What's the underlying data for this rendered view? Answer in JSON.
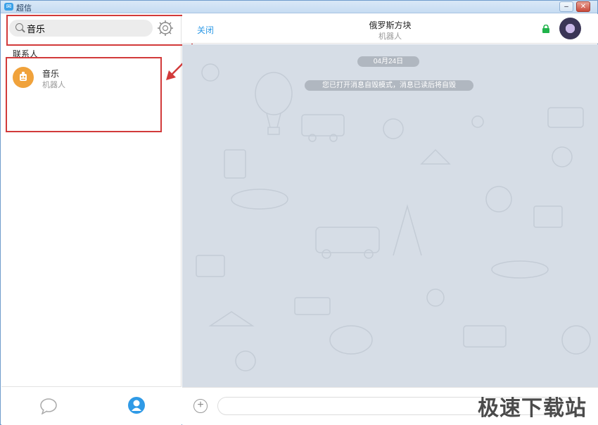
{
  "window": {
    "title": "超信"
  },
  "sidebar": {
    "search": {
      "value": "音乐",
      "placeholder": ""
    },
    "section_label": "联系人",
    "contacts": [
      {
        "name": "音乐",
        "subtitle": "机器人",
        "avatar_color": "#f0a23b"
      }
    ]
  },
  "chat": {
    "close_label": "关闭",
    "title": "俄罗斯方块",
    "subtitle": "机器人",
    "date_badge": "04月24日",
    "system_notice": "您已打开消息自毁模式，消息已读后将自毁",
    "input_placeholder": ""
  },
  "watermark": "极速下载站",
  "colors": {
    "accent": "#2f9ae6",
    "annotation_red": "#d23a3a",
    "chat_background": "#d6dde6",
    "lock_green": "#1fb34a"
  },
  "icons": [
    "search-icon",
    "gear-icon",
    "robot-icon",
    "chat-bubble-icon",
    "contacts-icon",
    "lock-icon",
    "plus-icon",
    "minimize-icon",
    "close-icon"
  ]
}
